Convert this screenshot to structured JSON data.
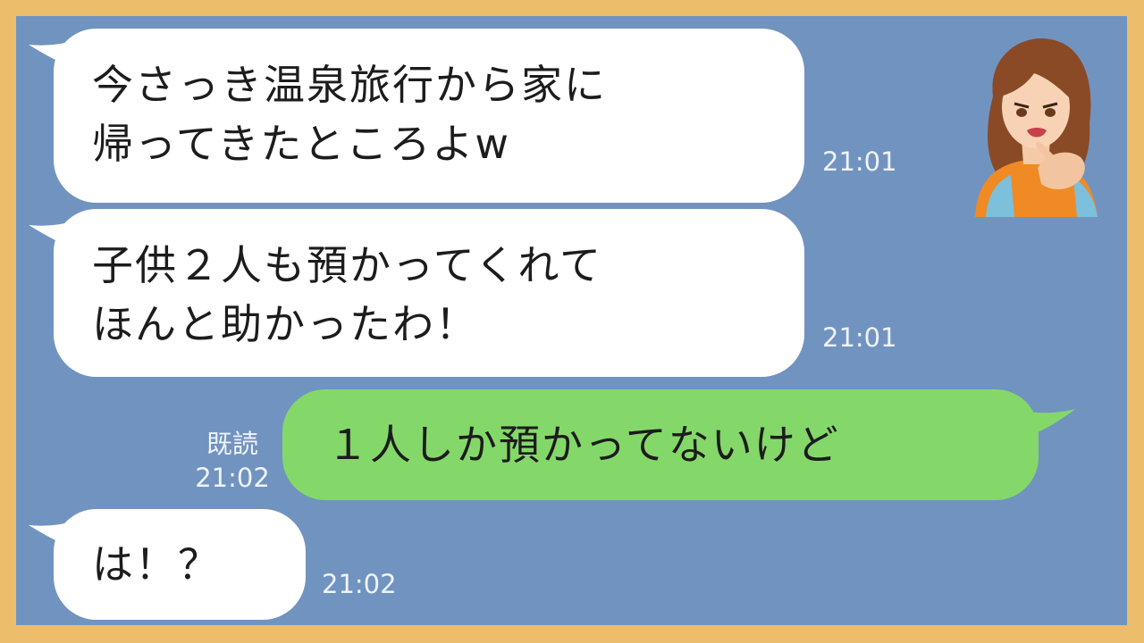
{
  "chat": {
    "messages": [
      {
        "side": "left",
        "lines": [
          "今さっき温泉旅行から家に",
          "帰ってきたところよw"
        ],
        "time": "21:01"
      },
      {
        "side": "left",
        "lines": [
          "子供２人も預かってくれて",
          "ほんと助かったわ！"
        ],
        "time": "21:01"
      },
      {
        "side": "right",
        "lines": [
          "１人しか預かってないけど"
        ],
        "read_label": "既読",
        "time": "21:02"
      },
      {
        "side": "left",
        "lines": [
          "は！？"
        ],
        "time": "21:02"
      }
    ]
  },
  "colors": {
    "frame": "#ecbd6a",
    "chat_background": "#7193c0",
    "incoming_bubble": "#ffffff",
    "outgoing_bubble": "#84d86a"
  },
  "icons": {
    "avatar": "angry-woman-pointing-avatar"
  }
}
